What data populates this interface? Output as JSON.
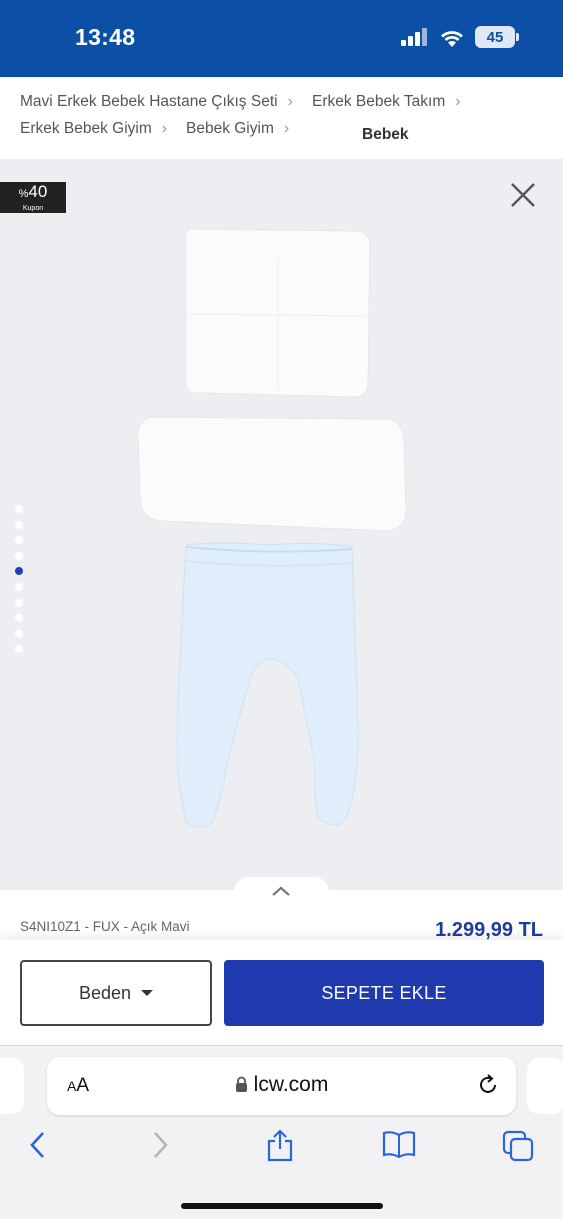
{
  "status_bar": {
    "time": "13:48",
    "battery": "45"
  },
  "breadcrumb": {
    "items": [
      "Mavi Erkek Bebek Hastane Çıkış Seti",
      "Erkek Bebek Takım",
      "Erkek Bebek Giyim",
      "Bebek Giyim"
    ],
    "current": "Bebek"
  },
  "gallery": {
    "coupon_percent_sign": "%",
    "coupon_value": "40",
    "coupon_label": "Kupon",
    "dot_count": 10,
    "active_dot": 4
  },
  "product": {
    "sku": "S4NI10Z1 - FUX - Açık Mavi",
    "price": "1.299,99 TL"
  },
  "actions": {
    "size_label": "Beden",
    "add_to_cart_label": "SEPETE EKLE"
  },
  "browser": {
    "text_size_small": "A",
    "text_size_large": "A",
    "domain": "lcw.com"
  },
  "colors": {
    "brand_blue": "#0b4fa6",
    "cart_blue": "#1e3aae",
    "price_blue": "#1e3d9c"
  }
}
